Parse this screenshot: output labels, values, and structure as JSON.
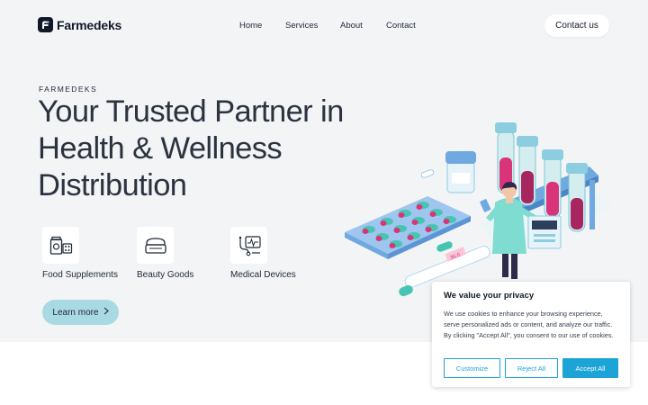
{
  "brand": {
    "name": "Farmedeks"
  },
  "nav": {
    "items": [
      {
        "label": "Home"
      },
      {
        "label": "Services"
      },
      {
        "label": "About"
      },
      {
        "label": "Contact"
      }
    ],
    "cta_label": "Contact us"
  },
  "hero": {
    "eyebrow": "FARMEDEKS",
    "headline": "Your Trusted Partner in Health & Wellness Distribution",
    "categories": [
      {
        "label": "Food Supplements",
        "icon": "supplements-icon"
      },
      {
        "label": "Beauty Goods",
        "icon": "beauty-icon"
      },
      {
        "label": "Medical Devices",
        "icon": "medical-device-icon"
      }
    ],
    "cta_label": "Learn more",
    "thermometer_reading": "36.6"
  },
  "cookie_banner": {
    "title": "We value your privacy",
    "text": "We use cookies to enhance your browsing experience, serve personalized ads or content, and analyze our traffic. By clicking \"Accept All\", you consent to our use of cookies.",
    "buttons": {
      "customize": "Customize",
      "reject": "Reject All",
      "accept": "Accept All"
    }
  },
  "colors": {
    "accent": "#1da4d6",
    "hero_bg": "#f3f4f6",
    "learn_more_bg": "#a9d9e3",
    "illustration_teal": "#48c4b3",
    "illustration_blue": "#6fa9e0",
    "illustration_pink": "#d9347a"
  }
}
